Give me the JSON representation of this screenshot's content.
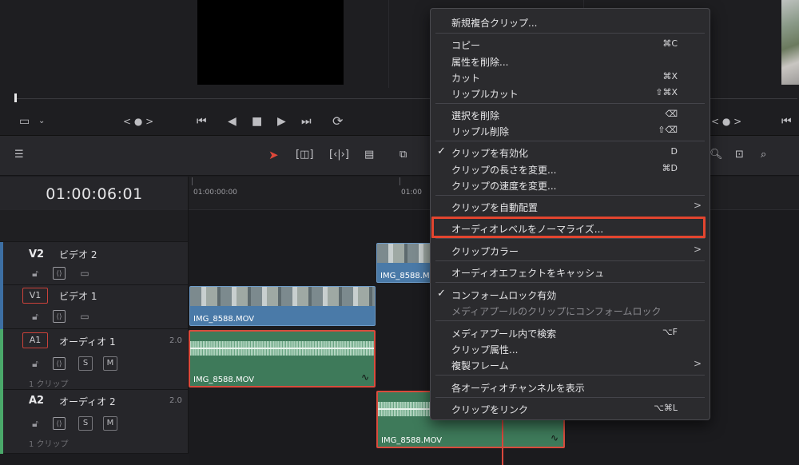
{
  "timecode": "01:00:06:01",
  "ruler": {
    "start": "01:00:00:00",
    "mid": "01:00"
  },
  "tracks": {
    "v2": {
      "id": "V2",
      "name": "ビデオ 2"
    },
    "v1": {
      "id": "V1",
      "name": "ビデオ 1"
    },
    "a1": {
      "id": "A1",
      "name": "オーディオ 1",
      "level": "2.0",
      "clips": "1 クリップ",
      "solo": "S",
      "mute": "M"
    },
    "a2": {
      "id": "A2",
      "name": "オーディオ 2",
      "level": "2.0",
      "clips": "1 クリップ",
      "solo": "S",
      "mute": "M"
    }
  },
  "clips": {
    "v2_clip": "IMG_8588.MOV",
    "v1_clip": "IMG_8588.MOV",
    "a1_clip": "IMG_8588.MOV",
    "a2_clip": "IMG_8588.MOV"
  },
  "transport": {
    "nav_left": "< ● >",
    "nav_right": "< ● >"
  },
  "menu": {
    "new_compound": "新規複合クリップ...",
    "copy": "コピー",
    "copy_sc": "⌘C",
    "remove_attr": "属性を削除...",
    "cut": "カット",
    "cut_sc": "⌘X",
    "ripple_cut": "リップルカット",
    "ripple_cut_sc": "⇧⌘X",
    "delete_sel": "選択を削除",
    "delete_sel_sc": "⌫",
    "ripple_delete": "リップル削除",
    "ripple_delete_sc": "⇧⌫",
    "enable_clip": "クリップを有効化",
    "enable_clip_sc": "D",
    "change_duration": "クリップの長さを変更...",
    "change_duration_sc": "⌘D",
    "change_speed": "クリップの速度を変更...",
    "auto_align": "クリップを自動配置",
    "normalize": "オーディオレベルをノーマライズ...",
    "clip_color": "クリップカラー",
    "cache_audio": "オーディオエフェクトをキャッシュ",
    "conform_lock": "コンフォームロック有効",
    "conform_lock_pool": "メディアプールのクリップにコンフォームロック",
    "find_in_pool": "メディアプール内で検索",
    "find_in_pool_sc": "⌥F",
    "clip_attributes": "クリップ属性...",
    "dup_frames": "複製フレーム",
    "show_channels": "各オーディオチャンネルを表示",
    "link_clips": "クリップをリンク",
    "link_clips_sc": "⌥⌘L"
  },
  "colors": {
    "video_clip": "#4a7aa8",
    "audio_clip": "#3e7a5a",
    "highlight": "#e3452f",
    "playhead": "#d9473b"
  }
}
